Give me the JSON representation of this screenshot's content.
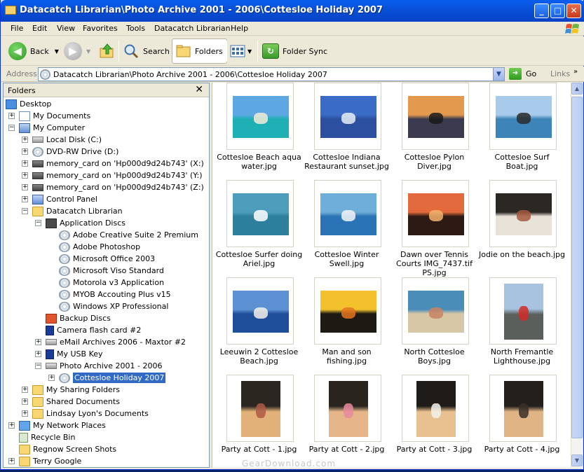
{
  "window": {
    "title": "Datacatch Librarian\\Photo Archive 2001 - 2006\\Cottesloe Holiday 2007",
    "minimize": "_",
    "maximize": "□",
    "close": "✕"
  },
  "menu": [
    "File",
    "Edit",
    "View",
    "Favorites",
    "Tools",
    "Datacatch Librarian",
    "Help"
  ],
  "toolbar": {
    "back": "Back",
    "search": "Search",
    "folders": "Folders",
    "folder_sync": "Folder Sync"
  },
  "address": {
    "label": "Address",
    "value": "Datacatch Librarian\\Photo Archive 2001 - 2006\\Cottesloe Holiday 2007",
    "go": "Go",
    "links": "Links"
  },
  "folders_pane": {
    "title": "Folders",
    "close": "✕",
    "tree": [
      {
        "label": "Desktop",
        "level": 0,
        "icon": "desktop-icon",
        "expander": ""
      },
      {
        "label": "My Documents",
        "level": 1,
        "icon": "documents-folder-icon",
        "expander": "+"
      },
      {
        "label": "My Computer",
        "level": 1,
        "icon": "computer-icon",
        "expander": "−"
      },
      {
        "label": "Local Disk (C:)",
        "level": 2,
        "icon": "hard-drive-icon",
        "expander": "+"
      },
      {
        "label": "DVD-RW Drive (D:)",
        "level": 2,
        "icon": "dvd-drive-icon",
        "expander": "+"
      },
      {
        "label": "memory_card on 'Hp000d9d24b743' (X:)",
        "level": 2,
        "icon": "network-drive-icon",
        "expander": "+"
      },
      {
        "label": "memory_card on 'Hp000d9d24b743' (Y:)",
        "level": 2,
        "icon": "network-drive-icon",
        "expander": "+"
      },
      {
        "label": "memory_card on 'Hp000d9d24b743' (Z:)",
        "level": 2,
        "icon": "network-drive-icon",
        "expander": "+"
      },
      {
        "label": "Control Panel",
        "level": 2,
        "icon": "control-panel-icon",
        "expander": "+"
      },
      {
        "label": "Datacatch Librarian",
        "level": 2,
        "icon": "librarian-icon",
        "expander": "−"
      },
      {
        "label": "Application Discs",
        "level": 3,
        "icon": "book-icon",
        "expander": "−"
      },
      {
        "label": "Adobe Creative Suite 2 Premium",
        "level": 4,
        "icon": "disc-icon",
        "expander": ""
      },
      {
        "label": "Adobe Photoshop",
        "level": 4,
        "icon": "disc-icon",
        "expander": ""
      },
      {
        "label": "Microsoft Office 2003",
        "level": 4,
        "icon": "disc-icon",
        "expander": ""
      },
      {
        "label": "Microsoft Viso Standard",
        "level": 4,
        "icon": "disc-icon",
        "expander": ""
      },
      {
        "label": "Motorola v3 Application",
        "level": 4,
        "icon": "disc-icon",
        "expander": ""
      },
      {
        "label": "MYOB Accouting Plus v15",
        "level": 4,
        "icon": "disc-icon",
        "expander": ""
      },
      {
        "label": "Windows XP Professional",
        "level": 4,
        "icon": "disc-icon",
        "expander": ""
      },
      {
        "label": "Backup Discs",
        "level": 3,
        "icon": "backup-icon",
        "expander": ""
      },
      {
        "label": "Camera flash card #2",
        "level": 3,
        "icon": "flash-card-icon",
        "expander": ""
      },
      {
        "label": "eMail Archives 2006 - Maxtor #2",
        "level": 3,
        "icon": "hard-drive-icon",
        "expander": "+"
      },
      {
        "label": "My USB Key",
        "level": 3,
        "icon": "usb-key-icon",
        "expander": "+"
      },
      {
        "label": "Photo Archive 2001 - 2006",
        "level": 3,
        "icon": "camera-icon",
        "expander": "−"
      },
      {
        "label": "Cottesloe Holiday 2007",
        "level": 4,
        "icon": "disc-icon",
        "expander": "+",
        "selected": true
      },
      {
        "label": "My Sharing Folders",
        "level": 2,
        "icon": "folder-icon",
        "expander": "+"
      },
      {
        "label": "Shared Documents",
        "level": 2,
        "icon": "folder-icon",
        "expander": "+"
      },
      {
        "label": "Lindsay Lyon's Documents",
        "level": 2,
        "icon": "folder-icon",
        "expander": "+"
      },
      {
        "label": "My Network Places",
        "level": 1,
        "icon": "network-icon",
        "expander": "+"
      },
      {
        "label": "Recycle Bin",
        "level": 1,
        "icon": "recycle-bin-icon",
        "expander": ""
      },
      {
        "label": "Regnow Screen Shots",
        "level": 1,
        "icon": "folder-icon",
        "expander": ""
      },
      {
        "label": "Terry Google",
        "level": 1,
        "icon": "folder-icon",
        "expander": "+"
      }
    ]
  },
  "thumbnails": [
    {
      "caption": "Cottesloe Beach aqua water.jpg",
      "sky": "#5DA8E3",
      "ground": "#1FB0B5",
      "accent": "#F2EBD8"
    },
    {
      "caption": "Cottesloe Indiana Restaurant sunset.jpg",
      "sky": "#3A6BC6",
      "ground": "#2C4FA0",
      "accent": "#E8EEF6"
    },
    {
      "caption": "Cottesloe Pylon Diver.jpg",
      "sky": "#E39A4E",
      "ground": "#3B3A4E",
      "accent": "#1A1A1A"
    },
    {
      "caption": "Cottesloe Surf Boat.jpg",
      "sky": "#A9CBEB",
      "ground": "#3D84B8",
      "accent": "#2A2A2A"
    },
    {
      "caption": "Cottesloe Surfer doing Ariel.jpg",
      "sky": "#4D9DBC",
      "ground": "#2D7F9E",
      "accent": "#FFFFFF"
    },
    {
      "caption": "Cottesloe Winter Swell.jpg",
      "sky": "#6FAED8",
      "ground": "#2A73B5",
      "accent": "#F3F5F8"
    },
    {
      "caption": "Dawn over Tennis Courts IMG_7437.tif PS.jpg",
      "sky": "#E26A3D",
      "ground": "#2E1A14",
      "accent": "#F3B26C"
    },
    {
      "caption": "Jodie on the beach.jpg",
      "sky": "#2B2824",
      "ground": "#E8E2D8",
      "accent": "#A4583E"
    },
    {
      "caption": "Leeuwin 2 Cottesloe Beach.jpg",
      "sky": "#5C92D3",
      "ground": "#1F4E9A",
      "accent": "#F4F1EA"
    },
    {
      "caption": "Man and son fishing.jpg",
      "sky": "#F2C12B",
      "ground": "#1C1A12",
      "accent": "#E4731E"
    },
    {
      "caption": "North Cottesloe Boys.jpg",
      "sky": "#4A8DB8",
      "ground": "#D8C7A6",
      "accent": "#C98463"
    },
    {
      "caption": "North Fremantle Lighthouse.jpg",
      "sky": "#A7C3E0",
      "ground": "#5A5F5C",
      "accent": "#D02B24"
    },
    {
      "caption": "Party at Cott - 1.jpg",
      "sky": "#2C2620",
      "ground": "#E2B17A",
      "accent": "#B05A48"
    },
    {
      "caption": "Party at Cott - 2.jpg",
      "sky": "#2A241F",
      "ground": "#E6B68A",
      "accent": "#E78A9E"
    },
    {
      "caption": "Party at Cott - 3.jpg",
      "sky": "#1F1B18",
      "ground": "#E9C08F",
      "accent": "#F5F2EC"
    },
    {
      "caption": "Party at Cott - 4.jpg",
      "sky": "#231F1C",
      "ground": "#E1B485",
      "accent": "#3A2E28"
    }
  ],
  "watermark": "GearDownload.com"
}
